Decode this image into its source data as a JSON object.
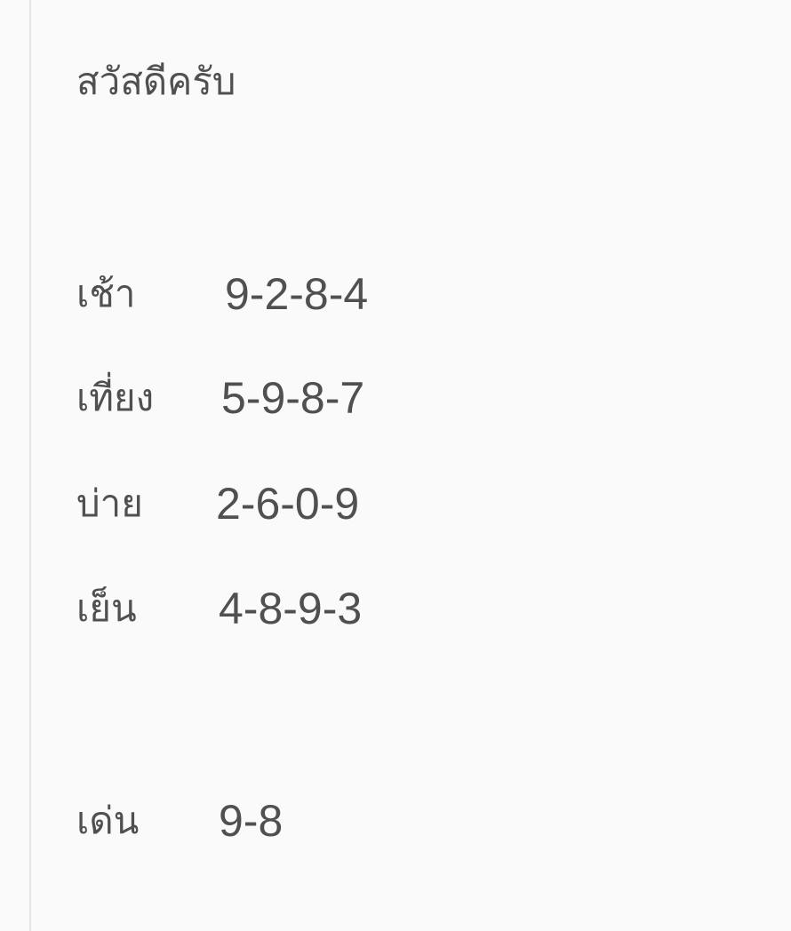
{
  "message": {
    "greeting": "สวัสดีครับ",
    "rounds": [
      {
        "label": "เช้า",
        "numbers": "9-2-8-4"
      },
      {
        "label": "เที่ยง",
        "numbers": "5-9-8-7"
      },
      {
        "label": "บ่าย",
        "numbers": "2-6-0-9"
      },
      {
        "label": "เย็น",
        "numbers": "4-8-9-3"
      }
    ],
    "highlight": {
      "label": "เด่น",
      "numbers": "9-8"
    }
  }
}
